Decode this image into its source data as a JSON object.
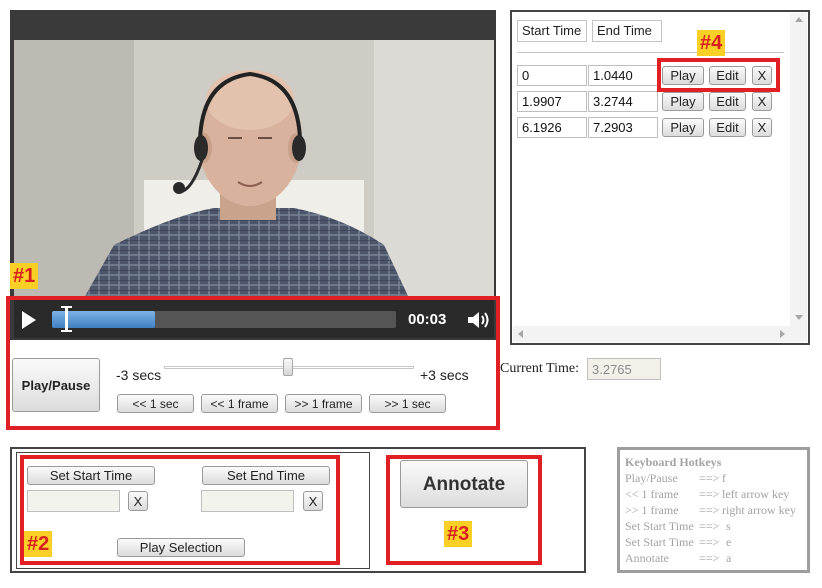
{
  "player": {
    "time_display": "00:03",
    "progress": 0.3
  },
  "controls": {
    "play_pause_label": "Play/Pause",
    "minus_label": "-3 secs",
    "plus_label": "+3 secs",
    "back_sec_label": "<< 1 sec",
    "back_frame_label": "<< 1 frame",
    "fwd_frame_label": ">> 1 frame",
    "fwd_sec_label": ">> 1 sec",
    "current_time_label": "Current Time:",
    "current_time_value": "3.2765"
  },
  "segments": {
    "start_header": "Start Time",
    "end_header": "End Time",
    "play_label": "Play",
    "edit_label": "Edit",
    "delete_label": "X",
    "rows": [
      {
        "start": "0",
        "end": "1.0440"
      },
      {
        "start": "1.9907",
        "end": "3.2744"
      },
      {
        "start": "6.1926",
        "end": "7.2903"
      }
    ]
  },
  "selection": {
    "set_start_label": "Set Start Time",
    "set_end_label": "Set End Time",
    "clear_label": "X",
    "play_selection_label": "Play Selection"
  },
  "annotate": {
    "label": "Annotate"
  },
  "hotkeys": {
    "title": "Keyboard Hotkeys",
    "items": [
      {
        "action": "Play/Pause",
        "arrow": "==>",
        "key": "f"
      },
      {
        "action": "<< 1 frame",
        "arrow": "==>",
        "key": "left arrow key"
      },
      {
        "action": ">> 1 frame",
        "arrow": "==>",
        "key": "right arrow key"
      },
      {
        "action": "Set Start Time",
        "arrow": "==>",
        "key": "s"
      },
      {
        "action": "Set Start Time",
        "arrow": "==>",
        "key": "e"
      },
      {
        "action": "Annotate",
        "arrow": "==>",
        "key": "a"
      }
    ]
  },
  "markers": {
    "m1": "#1",
    "m2": "#2",
    "m3": "#3",
    "m4": "#4"
  }
}
